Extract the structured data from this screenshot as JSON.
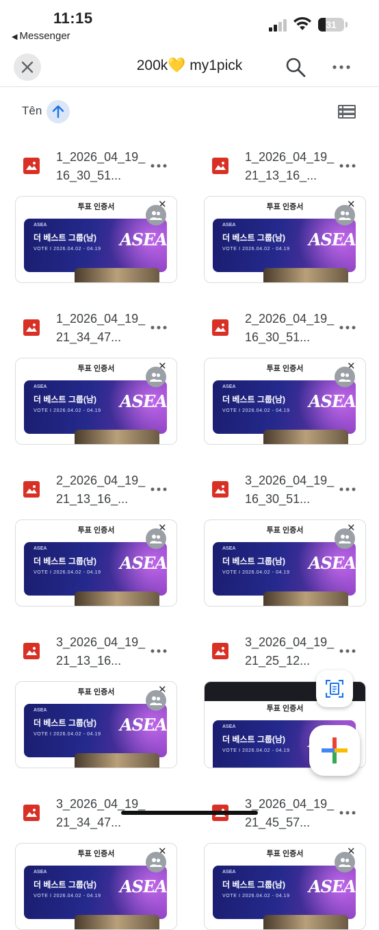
{
  "status_bar": {
    "time": "11:15",
    "back_app": "Messenger",
    "battery": "31"
  },
  "header": {
    "title": "200k💛 my1pick"
  },
  "sort": {
    "label": "Tên",
    "direction": "ascending"
  },
  "thumbnail": {
    "header": "투표 인증서",
    "close": "✕",
    "brand_small": "ASEA",
    "headline": "더 베스트 그룹(남)",
    "vote_line": "VOTE I 2026.04.02 - 04.19",
    "logo": "ASEA"
  },
  "files": [
    {
      "name": "1_2026_04_19_16_30_51..."
    },
    {
      "name": "1_2026_04_19_21_13_16_..."
    },
    {
      "name": "1_2026_04_19_21_34_47..."
    },
    {
      "name": "2_2026_04_19_16_30_51..."
    },
    {
      "name": "2_2026_04_19_21_13_16_..."
    },
    {
      "name": "3_2026_04_19_16_30_51..."
    },
    {
      "name": "3_2026_04_19_21_13_16..."
    },
    {
      "name": "3_2026_04_19_21_25_12..."
    },
    {
      "name": "3_2026_04_19_21_34_47..."
    },
    {
      "name": "3_2026_04_19_21_45_57..."
    }
  ],
  "colors": {
    "file_icon": "#d93025",
    "sort_bubble": "#dbe6f7",
    "accent_blue": "#1a73e8"
  },
  "icons": {
    "close": "close-icon",
    "search": "search-icon",
    "more": "more-horizontal-icon",
    "sort": "arrow-up-icon",
    "view": "list-view-icon",
    "file": "image-file-icon",
    "scan": "scan-document-icon",
    "add": "plus-icon"
  }
}
